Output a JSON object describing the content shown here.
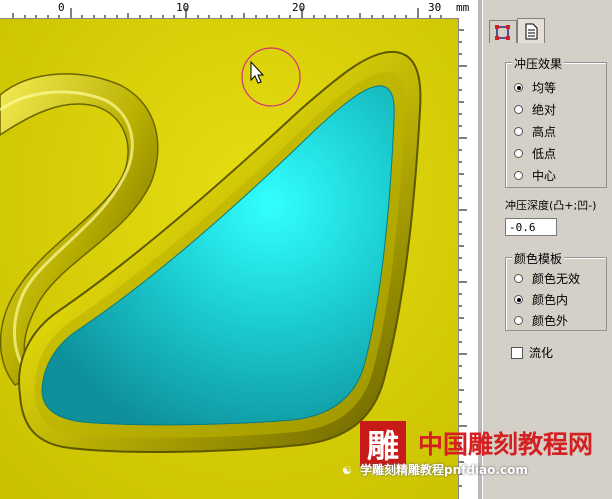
{
  "ruler": {
    "labels": [
      "0",
      "10",
      "20",
      "30",
      "mm"
    ]
  },
  "colors": {
    "background": "#d8d000",
    "relief": "#c8c000",
    "cyan_fill": "#19c7c9",
    "panel": "#d4d0c8"
  },
  "panel": {
    "tabs": [
      {
        "icon": "node-edit-icon"
      },
      {
        "icon": "document-icon"
      }
    ],
    "emboss_group": {
      "title": "冲压效果",
      "options": [
        {
          "label": "均等",
          "selected": true
        },
        {
          "label": "绝对",
          "selected": false
        },
        {
          "label": "高点",
          "selected": false
        },
        {
          "label": "低点",
          "selected": false
        },
        {
          "label": "中心",
          "selected": false
        }
      ]
    },
    "depth": {
      "label": "冲压深度(凸+;凹-)",
      "value": "-0.6"
    },
    "color_group": {
      "title": "颜色模板",
      "options": [
        {
          "label": "颜色无效",
          "selected": false
        },
        {
          "label": "颜色内",
          "selected": true
        },
        {
          "label": "颜色外",
          "selected": false
        }
      ]
    },
    "smooth": {
      "label": "流化",
      "checked": false
    }
  },
  "watermark": {
    "logo_char": "雕",
    "title": "中国雕刻教程网",
    "subtitle": "学雕刻精雕教程pnfdiao.com"
  }
}
